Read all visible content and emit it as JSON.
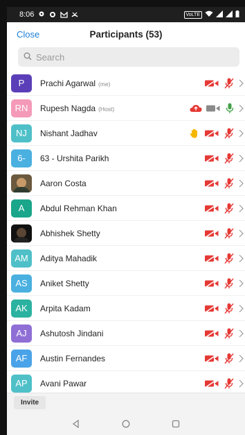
{
  "status_bar": {
    "time": "8:06",
    "network_label": "VoLTE"
  },
  "header": {
    "close_label": "Close",
    "title": "Participants (53)"
  },
  "search": {
    "placeholder": "Search"
  },
  "colors": {
    "accent": "#1c7ed6",
    "muted_red": "#e53935",
    "green": "#43a047",
    "hand": "#f5b700"
  },
  "participants": [
    {
      "initials": "P",
      "avatar_color": "#5b3fb8",
      "name": "Prachi Agarwal",
      "tag": "(me)",
      "hand": false,
      "cloud": false,
      "video_on": false,
      "mic_on": false
    },
    {
      "initials": "RN",
      "avatar_color": "#f49ab8",
      "name": "Rupesh Nagda",
      "tag": "(Host)",
      "hand": false,
      "cloud": true,
      "video_on": true,
      "mic_on": true
    },
    {
      "initials": "NJ",
      "avatar_color": "#4fc0c8",
      "name": "Nishant Jadhav",
      "tag": "",
      "hand": true,
      "cloud": false,
      "video_on": false,
      "mic_on": false
    },
    {
      "initials": "6-",
      "avatar_color": "#4ab0e0",
      "name": "63 - Urshita Parikh",
      "tag": "",
      "hand": false,
      "cloud": false,
      "video_on": false,
      "mic_on": false
    },
    {
      "initials": "",
      "avatar_color": "",
      "name": "Aaron Costa",
      "tag": "",
      "photo": "light",
      "hand": false,
      "cloud": false,
      "video_on": false,
      "mic_on": false
    },
    {
      "initials": "A",
      "avatar_color": "#1aa68a",
      "name": "Abdul Rehman Khan",
      "tag": "",
      "hand": false,
      "cloud": false,
      "video_on": false,
      "mic_on": false
    },
    {
      "initials": "",
      "avatar_color": "",
      "name": "Abhishek Shetty",
      "tag": "",
      "photo": "dark",
      "hand": false,
      "cloud": false,
      "video_on": false,
      "mic_on": false
    },
    {
      "initials": "AM",
      "avatar_color": "#4fc0c8",
      "name": "Aditya Mahadik",
      "tag": "",
      "hand": false,
      "cloud": false,
      "video_on": false,
      "mic_on": false
    },
    {
      "initials": "AS",
      "avatar_color": "#4ab0e0",
      "name": "Aniket Shetty",
      "tag": "",
      "hand": false,
      "cloud": false,
      "video_on": false,
      "mic_on": false
    },
    {
      "initials": "AK",
      "avatar_color": "#2bb2a0",
      "name": "Arpita Kadam",
      "tag": "",
      "hand": false,
      "cloud": false,
      "video_on": false,
      "mic_on": false
    },
    {
      "initials": "AJ",
      "avatar_color": "#8f6ed5",
      "name": "Ashutosh Jindani",
      "tag": "",
      "hand": false,
      "cloud": false,
      "video_on": false,
      "mic_on": false
    },
    {
      "initials": "AF",
      "avatar_color": "#4aa3e8",
      "name": "Austin Fernandes",
      "tag": "",
      "hand": false,
      "cloud": false,
      "video_on": false,
      "mic_on": false
    },
    {
      "initials": "AP",
      "avatar_color": "#4fc0c8",
      "name": "Avani Pawar",
      "tag": "",
      "hand": false,
      "cloud": false,
      "video_on": false,
      "mic_on": false
    }
  ],
  "footer": {
    "invite_label": "Invite"
  },
  "nav": {
    "icons": [
      "back-icon",
      "home-icon",
      "recents-icon"
    ]
  }
}
